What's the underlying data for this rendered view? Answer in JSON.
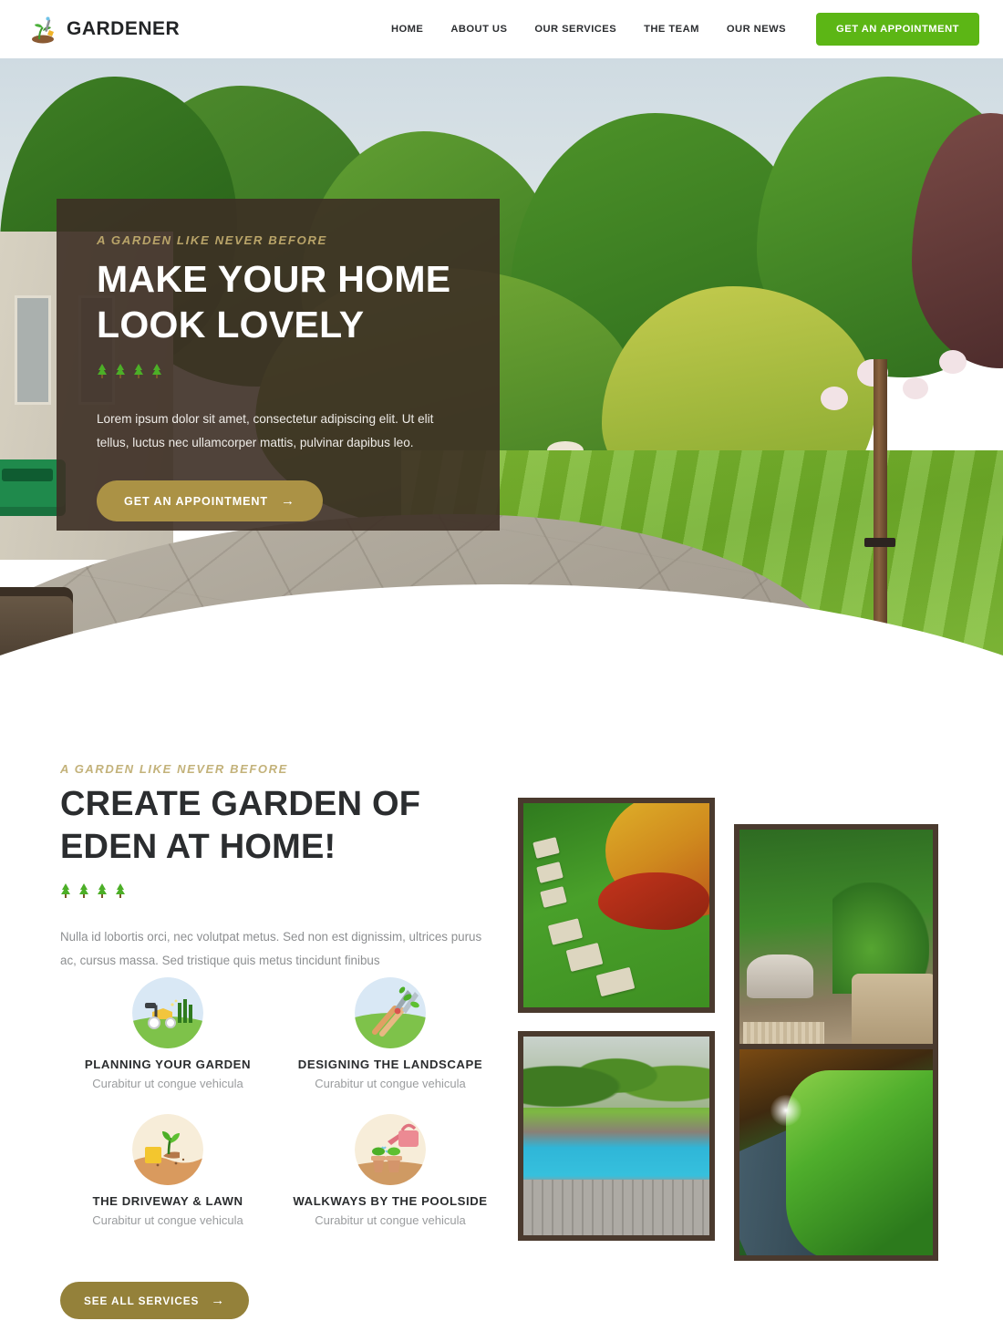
{
  "header": {
    "logo": {
      "icon": "seedling-shovel-icon",
      "text": "GARDENER"
    },
    "nav": [
      {
        "label": "HOME"
      },
      {
        "label": "ABOUT US"
      },
      {
        "label": "OUR SERVICES"
      },
      {
        "label": "THE TEAM"
      },
      {
        "label": "OUR NEWS"
      }
    ],
    "cta": {
      "label": "GET AN APPOINTMENT",
      "color": "#5cb615"
    }
  },
  "hero": {
    "eyebrow": "A GARDEN LIKE NEVER BEFORE",
    "title_line1": "MAKE YOUR HOME",
    "title_line2": "LOOK LOVELY",
    "paragraph": "Lorem ipsum dolor sit amet, consectetur adipiscing elit. Ut elit tellus, luctus nec ullamcorper mattis, pulvinar dapibus leo.",
    "button": {
      "label": "GET AN APPOINTMENT",
      "arrow": "→",
      "color": "#ab9245"
    },
    "overlay_color": "#3d2f25",
    "decoration": "four-pine-trees",
    "background": "garden-lawn-patio-photo"
  },
  "section2": {
    "eyebrow": "A GARDEN LIKE NEVER BEFORE",
    "title_line1": "CREATE GARDEN OF",
    "title_line2": "EDEN AT HOME!",
    "paragraph": "Nulla id lobortis orci, nec volutpat metus. Sed non est dignissim, ultrices purus ac, cursus massa. Sed tristique quis metus tincidunt finibus",
    "decoration": "four-pine-trees",
    "features": [
      {
        "icon": "lawn-mower-icon",
        "title": "PLANNING YOUR GARDEN",
        "subtitle": "Curabitur ut congue vehicula"
      },
      {
        "icon": "hedge-shears-icon",
        "title": "DESIGNING THE LANDSCAPE",
        "subtitle": "Curabitur ut congue vehicula"
      },
      {
        "icon": "seedling-soil-icon",
        "title": "THE DRIVEWAY & LAWN",
        "subtitle": "Curabitur ut congue vehicula"
      },
      {
        "icon": "watering-can-pots-icon",
        "title": "WALKWAYS BY THE POOLSIDE",
        "subtitle": "Curabitur ut congue vehicula"
      }
    ],
    "button": {
      "label": "SEE ALL SERVICES",
      "arrow": "→",
      "color": "#94813a"
    },
    "gallery": [
      {
        "alt": "garden-bed-with-stepping-stones"
      },
      {
        "alt": "patio-with-wicker-furniture-and-palms"
      },
      {
        "alt": "swimming-pool-with-wooden-deck"
      },
      {
        "alt": "illuminated-hedge-at-dusk"
      }
    ]
  },
  "colors": {
    "brand_green": "#5cb615",
    "gold": "#ab9245",
    "gold_dark": "#94813a",
    "overlay_brown": "#3d2f25",
    "heading": "#2b2d2f",
    "body_text": "#8d8f91",
    "frame": "#4a3a2e"
  }
}
